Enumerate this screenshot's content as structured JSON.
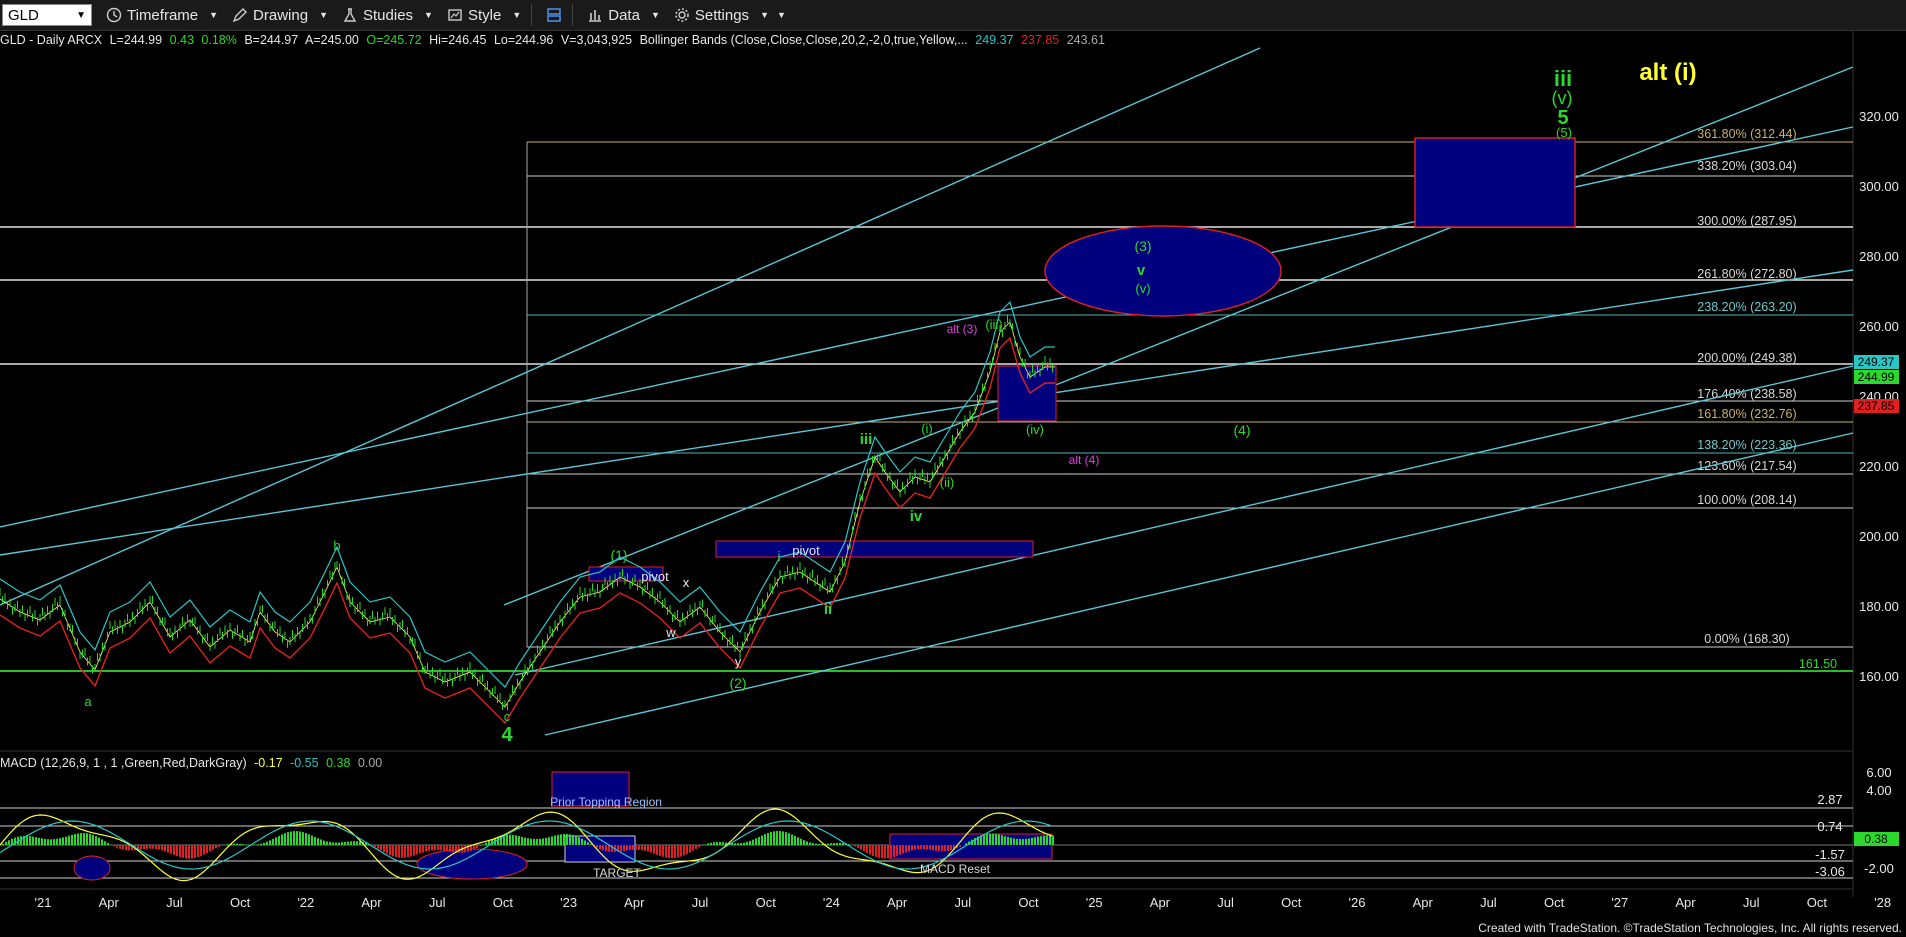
{
  "toolbar": {
    "symbol": "GLD",
    "timeframe": "Timeframe",
    "drawing": "Drawing",
    "studies": "Studies",
    "style": "Style",
    "data": "Data",
    "settings": "Settings"
  },
  "header": {
    "instrument": "GLD - Daily  ARCX",
    "last": "L=244.99",
    "change": "0.43",
    "change_pct": "0.18%",
    "bid": "B=244.97",
    "ask": "A=245.00",
    "open": "O=245.72",
    "high": "Hi=246.45",
    "low": "Lo=244.96",
    "volume": "V=3,043,925",
    "study": "Bollinger Bands (Close,Close,Close,20,2,-2,0,true,Yellow,...",
    "bb_upper": "249.37",
    "bb_lower": "237.85",
    "bb_mid": "243.61"
  },
  "macd_header": {
    "label": "MACD (12,26,9, 1 , 1 ,Green,Red,DarkGray)",
    "macd": "-0.17",
    "signal": "-0.55",
    "hist": "0.38",
    "zero": "0.00"
  },
  "price_axis": [
    "320.00",
    "300.00",
    "280.00",
    "260.00",
    "240.00",
    "220.00",
    "200.00",
    "180.00",
    "160.00"
  ],
  "price_badges": {
    "upper": "249.37",
    "last": "244.99",
    "lower": "237.85"
  },
  "macd_axis": [
    "6.00",
    "4.00",
    "2.87",
    "0.74",
    "0.38",
    "-1.57",
    "-2.00",
    "-3.06"
  ],
  "time_axis": [
    "'21",
    "Apr",
    "Jul",
    "Oct",
    "'22",
    "Apr",
    "Jul",
    "Oct",
    "'23",
    "Apr",
    "Jul",
    "Oct",
    "'24",
    "Apr",
    "Jul",
    "Oct",
    "'25",
    "Apr",
    "Jul",
    "Oct",
    "'26",
    "Apr",
    "Jul",
    "Oct",
    "'27",
    "Apr",
    "Jul",
    "Oct",
    "'28"
  ],
  "fib_levels": [
    {
      "label": "361.80% (312.44)",
      "color": "#cbb06b"
    },
    {
      "label": "338.20% (303.04)",
      "color": "#d8d8d8"
    },
    {
      "label": "300.00% (287.95)",
      "color": "#d8d8d8"
    },
    {
      "label": "261.80% (272.80)",
      "color": "#d8d8d8"
    },
    {
      "label": "238.20% (263.20)",
      "color": "#6fc9c9"
    },
    {
      "label": "200.00% (249.38)",
      "color": "#d8d8d8"
    },
    {
      "label": "176.40% (238.58)",
      "color": "#d8d8d8"
    },
    {
      "label": "161.80% (232.76)",
      "color": "#cbb06b"
    },
    {
      "label": "138.20% (223.36)",
      "color": "#6fc9c9"
    },
    {
      "label": "123.60% (217.54)",
      "color": "#d8d8d8"
    },
    {
      "label": "100.00% (208.14)",
      "color": "#d8d8d8"
    },
    {
      "label": "0.00% (168.30)",
      "color": "#d8d8d8"
    }
  ],
  "support_label": "161.50",
  "annotations": {
    "wave_a": "a",
    "wave_b": "b",
    "wave_c": "c",
    "wave_4": "4",
    "wave_1p": "(1)",
    "wave_2p": "(2)",
    "pivot1": "pivot",
    "pivot2": "pivot",
    "wave_w": "w",
    "wave_x": "x",
    "wave_y": "y",
    "wave_i": "i",
    "wave_ii": "ii",
    "wave_iii": "iii",
    "wave_iv": "iv",
    "wave_ip": "(i)",
    "wave_iip": "(ii)",
    "wave_iiip": "(iii)",
    "wave_ivp": "(iv)",
    "alt3": "alt (3)",
    "alt4": "alt (4)",
    "wave_3p": "(3)",
    "wave_v": "v",
    "wave_vp": "(v)",
    "wave_4p": "(4)",
    "top_iii": "iii",
    "top_vp": "(v)",
    "top_5": "5",
    "top_5p": "(5)",
    "alt_i": "alt (i)",
    "prior_topping": "Prior Topping Region",
    "target": "TARGET",
    "macd_reset": "MACD Reset"
  },
  "colors": {
    "green": "#2bd82b",
    "red": "#e02020",
    "cyan": "#59c7d6",
    "navy": "#00007f",
    "magenta": "#e040e0",
    "yellow": "#ffff33"
  },
  "footer": "Created with TradeStation. ©TradeStation Technologies, Inc. All rights reserved."
}
